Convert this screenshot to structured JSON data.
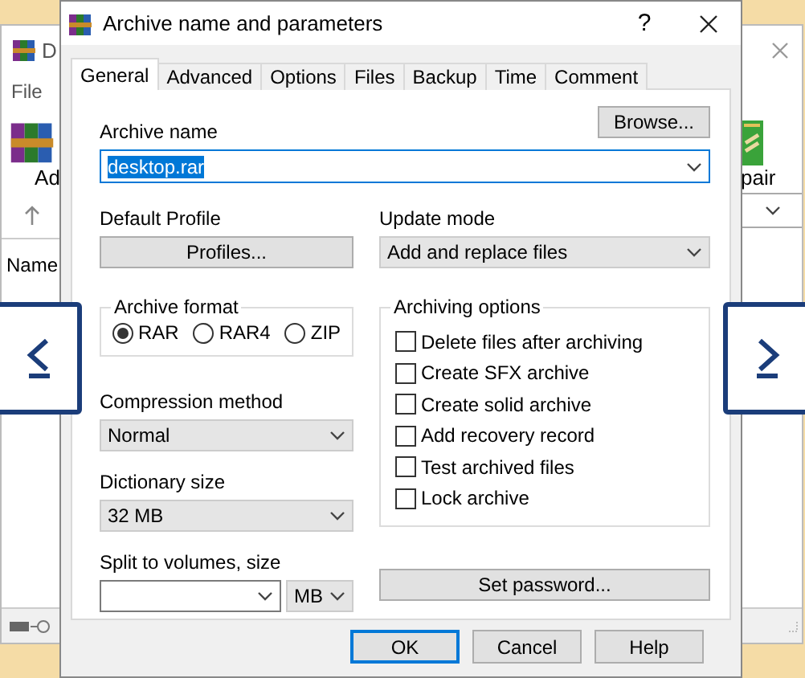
{
  "background_window": {
    "title": "D",
    "menu": [
      "File"
    ],
    "toolbar": [
      {
        "label": "Ad"
      },
      {
        "label": "pair"
      }
    ],
    "column_header": "Name"
  },
  "dialog": {
    "title": "Archive name and parameters",
    "help": "?",
    "tabs": [
      {
        "label": "General",
        "selected": true
      },
      {
        "label": "Advanced",
        "selected": false
      },
      {
        "label": "Options",
        "selected": false
      },
      {
        "label": "Files",
        "selected": false
      },
      {
        "label": "Backup",
        "selected": false
      },
      {
        "label": "Time",
        "selected": false
      },
      {
        "label": "Comment",
        "selected": false
      }
    ],
    "archive_name": {
      "label": "Archive name",
      "value": "desktop.rar",
      "browse": "Browse..."
    },
    "default_profile": {
      "label": "Default Profile",
      "button": "Profiles..."
    },
    "update_mode": {
      "label": "Update mode",
      "value": "Add and replace files"
    },
    "archive_format": {
      "label": "Archive format",
      "options": [
        {
          "label": "RAR",
          "selected": true
        },
        {
          "label": "RAR4",
          "selected": false
        },
        {
          "label": "ZIP",
          "selected": false
        }
      ]
    },
    "compression_method": {
      "label": "Compression method",
      "value": "Normal"
    },
    "dictionary_size": {
      "label": "Dictionary size",
      "value": "32 MB"
    },
    "split_volumes": {
      "label": "Split to volumes, size",
      "unit": "MB"
    },
    "archiving_options": {
      "label": "Archiving options",
      "items": [
        {
          "label": "Delete files after archiving",
          "checked": false
        },
        {
          "label": "Create SFX archive",
          "checked": false
        },
        {
          "label": "Create solid archive",
          "checked": false
        },
        {
          "label": "Add recovery record",
          "checked": false
        },
        {
          "label": "Test archived files",
          "checked": false
        },
        {
          "label": "Lock archive",
          "checked": false
        }
      ]
    },
    "set_password": "Set password...",
    "buttons": [
      "OK",
      "Cancel",
      "Help"
    ]
  }
}
